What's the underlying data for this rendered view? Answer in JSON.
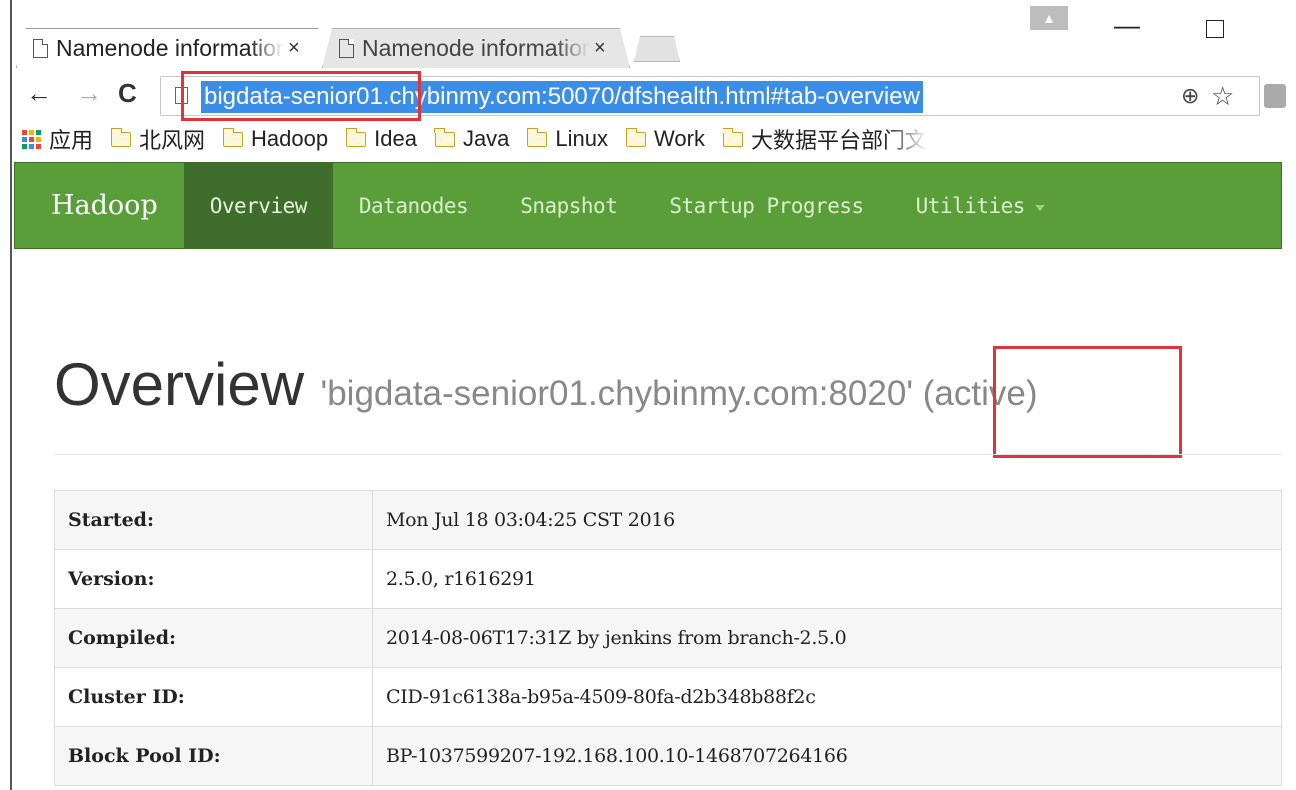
{
  "browser": {
    "tabs": [
      {
        "title": "Namenode information",
        "close": "×",
        "active": true
      },
      {
        "title": "Namenode information",
        "close": "×",
        "active": false
      }
    ],
    "url": "bigdata-senior01.chybinmy.com:50070/dfshealth.html#tab-overview",
    "nav": {
      "back": "←",
      "forward": "→",
      "reload": "C"
    },
    "bookmarks": [
      {
        "label": "应用",
        "icon": "apps-icon"
      },
      {
        "label": "北风网",
        "icon": "folder-icon"
      },
      {
        "label": "Hadoop",
        "icon": "folder-icon"
      },
      {
        "label": "Idea",
        "icon": "folder-icon"
      },
      {
        "label": "Java",
        "icon": "folder-icon"
      },
      {
        "label": "Linux",
        "icon": "folder-icon"
      },
      {
        "label": "Work",
        "icon": "folder-icon"
      },
      {
        "label": "大数据平台部门文",
        "icon": "folder-icon"
      }
    ],
    "window_controls": {
      "minimize": "—"
    }
  },
  "navbar": {
    "brand": "Hadoop",
    "links": [
      {
        "label": "Overview",
        "active": true
      },
      {
        "label": "Datanodes",
        "active": false
      },
      {
        "label": "Snapshot",
        "active": false
      },
      {
        "label": "Startup Progress",
        "active": false
      },
      {
        "label": "Utilities",
        "active": false,
        "dropdown": true
      }
    ],
    "colors": {
      "bar": "#5a9e3a",
      "active": "#3e6d2c"
    }
  },
  "overview": {
    "title": "Overview",
    "host": "'bigdata-senior01.chybinmy.com:8020' (active)"
  },
  "info_table": [
    {
      "key": "Started:",
      "value": "Mon Jul 18 03:04:25 CST 2016"
    },
    {
      "key": "Version:",
      "value": "2.5.0, r1616291"
    },
    {
      "key": "Compiled:",
      "value": "2014-08-06T17:31Z by jenkins from branch-2.5.0"
    },
    {
      "key": "Cluster ID:",
      "value": "CID-91c6138a-b95a-4509-80fa-d2b348b88f2c"
    },
    {
      "key": "Block Pool ID:",
      "value": "BP-1037599207-192.168.100.10-1468707264166"
    }
  ],
  "annotation_color": "#e0343a"
}
